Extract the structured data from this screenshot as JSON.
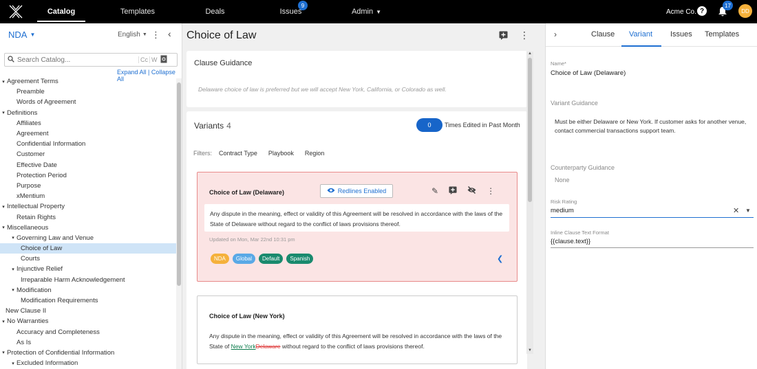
{
  "nav": {
    "items": [
      {
        "label": "Catalog",
        "active": true
      },
      {
        "label": "Templates"
      },
      {
        "label": "Deals"
      },
      {
        "label": "Issues",
        "badge": "9"
      },
      {
        "label": "Admin",
        "dropdown": true
      }
    ],
    "org": "Acme Co.",
    "notifications": "17",
    "avatar_initials": "DD"
  },
  "sidebar": {
    "catalog_name": "NDA",
    "language": "English",
    "search_placeholder": "Search Catalog...",
    "search_scope_c": "Cc",
    "search_scope_w": "W",
    "expand_all": "Expand All",
    "collapse_all": "Collapse All",
    "tree": [
      {
        "label": "Agreement Terms",
        "level": 0,
        "caret": true
      },
      {
        "label": "Preamble",
        "level": 1
      },
      {
        "label": "Words of Agreement",
        "level": 1
      },
      {
        "label": "Definitions",
        "level": 0,
        "caret": true
      },
      {
        "label": "Affiliates",
        "level": 1
      },
      {
        "label": "Agreement",
        "level": 1
      },
      {
        "label": "Confidential Information",
        "level": 1
      },
      {
        "label": "Customer",
        "level": 1
      },
      {
        "label": "Effective Date",
        "level": 1
      },
      {
        "label": "Protection Period",
        "level": 1
      },
      {
        "label": "Purpose",
        "level": 1
      },
      {
        "label": "xMentium",
        "level": 1
      },
      {
        "label": "Intellectual Property",
        "level": 0,
        "caret": true
      },
      {
        "label": "Retain Rights",
        "level": 1
      },
      {
        "label": "Miscellaneous",
        "level": 0,
        "caret": true
      },
      {
        "label": "Governing Law and Venue",
        "level": 1,
        "caret": true
      },
      {
        "label": "Choice of Law",
        "level": 2,
        "selected": true
      },
      {
        "label": "Courts",
        "level": 2
      },
      {
        "label": "Injunctive Relief",
        "level": 1,
        "caret": true
      },
      {
        "label": "Irreparable Harm Acknowledgement",
        "level": 2
      },
      {
        "label": "Modification",
        "level": 1,
        "caret": true
      },
      {
        "label": "Modification Requirements",
        "level": 2
      },
      {
        "label": "New Clause II",
        "level": 0
      },
      {
        "label": "No Warranties",
        "level": 0,
        "caret": true
      },
      {
        "label": "Accuracy and Completeness",
        "level": 1
      },
      {
        "label": "As Is",
        "level": 1
      },
      {
        "label": "Protection of Confidential Information",
        "level": 0,
        "caret": true
      },
      {
        "label": "Excluded Information",
        "level": 1,
        "caret": true
      }
    ]
  },
  "main": {
    "title": "Choice of Law",
    "guidance_title": "Clause Guidance",
    "guidance_text": "Delaware choice of law is preferred but we will accept New York, California, or Colorado as well.",
    "variants_label": "Variants",
    "variants_count": "4",
    "times_edited_value": "0",
    "times_edited_label": "Times Edited in Past Month",
    "filters_label": "Filters:",
    "filters": [
      "Contract Type",
      "Playbook",
      "Region"
    ],
    "variant1": {
      "name": "Choice of Law (Delaware)",
      "redlines_label": "Redlines Enabled",
      "text": "Any dispute in the meaning, effect or validity of this Agreement will be resolved in accordance with the laws of the State of Delaware without regard to the conflict of laws provisions thereof.",
      "updated": "Updated on Mon, Mar 22nd 10:31 pm",
      "tags": [
        {
          "label": "NDA",
          "color": "#f5b13b"
        },
        {
          "label": "Global",
          "color": "#5aa9e6"
        },
        {
          "label": "Default",
          "color": "#1a8a6e"
        },
        {
          "label": "Spanish",
          "color": "#1a8a6e"
        }
      ]
    },
    "variant2": {
      "name": "Choice of Law (New York)",
      "text_before": "Any dispute in the meaning, effect or validity of this Agreement will be resolved in accordance with the laws of the State of ",
      "text_inserted": "New York",
      "text_deleted": "Delaware",
      "text_after": " without regard to the conflict of laws provisions thereof."
    }
  },
  "right": {
    "tabs": [
      "Clause",
      "Variant",
      "Issues",
      "Templates"
    ],
    "active_tab": "Variant",
    "name_label": "Name*",
    "name_value": "Choice of Law (Delaware)",
    "variant_guidance_label": "Variant Guidance",
    "variant_guidance_text": "Must be either Delaware or New York. If customer asks for another venue, contact commercial transactions support team.",
    "counterparty_label": "Counterparty Guidance",
    "counterparty_value": "None",
    "risk_label": "Risk Rating",
    "risk_value": "medium",
    "inline_label": "Inline Clause Text Format",
    "inline_value": "{{clause.text}}"
  },
  "colors": {
    "accent": "#1e6fd1",
    "selected_row": "#cfe4f7",
    "variant_highlight_bg": "#fbe4e4",
    "variant_highlight_border": "#e88a8a"
  }
}
